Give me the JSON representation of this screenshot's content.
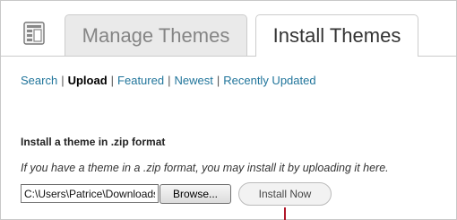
{
  "tabs": [
    {
      "label": "Manage Themes"
    },
    {
      "label": "Install Themes"
    }
  ],
  "subnav": [
    {
      "label": "Search"
    },
    {
      "label": "Upload"
    },
    {
      "label": "Featured"
    },
    {
      "label": "Newest"
    },
    {
      "label": "Recently Updated"
    }
  ],
  "subnav_separator": "|",
  "upload": {
    "heading": "Install a theme in .zip format",
    "help_text": "If you have a theme in a .zip format, you may install it by uploading it here.",
    "file_value": "C:\\Users\\Patrice\\Downloads",
    "browse_label": "Browse...",
    "install_label": "Install Now"
  },
  "colors": {
    "link": "#21759b",
    "marker": "#b0182a"
  }
}
